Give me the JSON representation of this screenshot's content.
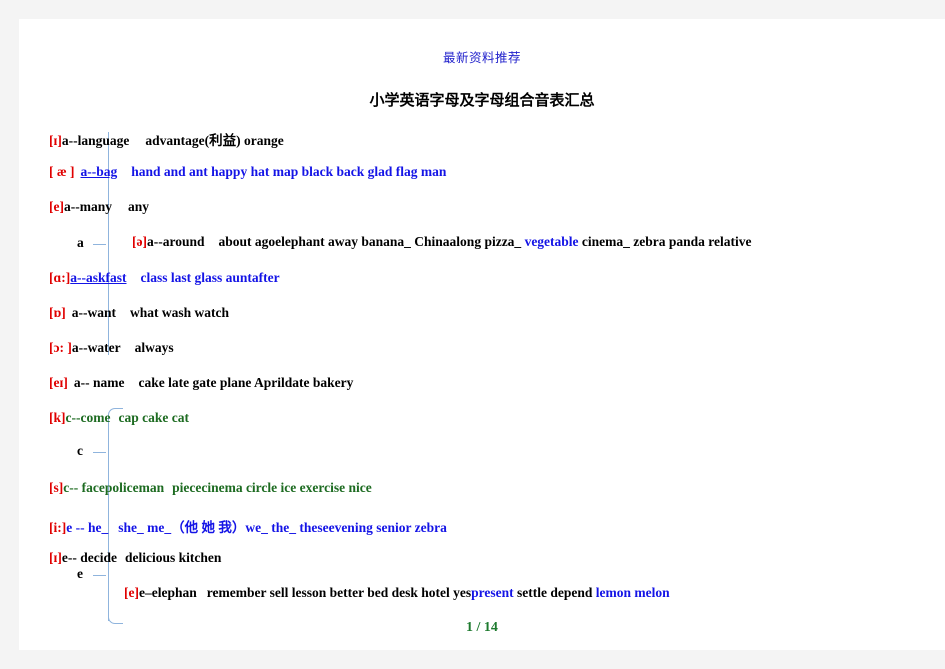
{
  "header": {
    "watermark_text": "最新资料推荐",
    "rule_color": "#2222cc"
  },
  "title": "小学英语字母及字母组合音表汇总",
  "footer": {
    "page_label": "1 / 14",
    "color": "#1d7a2e"
  },
  "colors": {
    "phonetic": "#e00000",
    "black": "#000000",
    "blue": "#1414e6",
    "green": "#1d6b21",
    "bracket": "#8fb4dd"
  },
  "groups": [
    {
      "letter": "a",
      "label": "a"
    },
    {
      "letter": "c",
      "label": "c"
    },
    {
      "letter": "e",
      "label": "e"
    }
  ],
  "rows": [
    {
      "id": "row-i-a",
      "phonetic": "[ɪ]",
      "lead": "a--language",
      "words": "advantage(利益)   orange",
      "color": "black"
    },
    {
      "id": "row-ae-a",
      "phonetic": "[ æ ]",
      "lead": "a--bag",
      "words": "hand   and   ant   happy   hat   map   black   back   glad   flag   man",
      "color": "blue"
    },
    {
      "id": "row-e-a",
      "phonetic": "[e]",
      "lead": "a--many",
      "words": "any",
      "color": "black"
    },
    {
      "id": "row-schwa-a",
      "phonetic": "[ə]",
      "lead": "a--around",
      "words": "about agoelephant   away   banana_   Chinaalong pizza_ vegetable cinema_   zebra panda relative",
      "color": "black",
      "blue_words": [
        "vegetable"
      ]
    },
    {
      "id": "row-aa-a",
      "phonetic": "[ɑ:]",
      "lead": "a--askfast",
      "words": "class   last   glass   auntafter",
      "color": "blue"
    },
    {
      "id": "row-o-a",
      "phonetic": "[ɒ]",
      "lead": "a--want",
      "words": "what   wash   watch",
      "color": "black"
    },
    {
      "id": "row-oo-a",
      "phonetic": "[ɔ: ]",
      "lead": "a--water",
      "words": "always",
      "color": "black"
    },
    {
      "id": "row-ei-a",
      "phonetic": "[eɪ]",
      "lead": "a--  name",
      "words": "cake   late   gate   plane   Aprildate   bakery",
      "color": "black"
    },
    {
      "id": "row-k-c",
      "phonetic": "[k]",
      "lead": "c--come",
      "words": "cap cake   cat",
      "color": "green"
    },
    {
      "id": "row-s-c",
      "phonetic": "[s]",
      "lead": "c--  facepoliceman",
      "words": "piececinema circle   ice   exercise   nice",
      "color": "green"
    },
    {
      "id": "row-ii-e",
      "phonetic": "[i:]",
      "lead": "e -- he_",
      "words": "she_   me_（他 她 我）we_ the_   theseevening   senior   zebra",
      "color": "blue"
    },
    {
      "id": "row-i-e",
      "phonetic": "[ɪ]",
      "lead": "e--  decide",
      "words": "delicious   kitchen",
      "color": "black"
    },
    {
      "id": "row-e-e",
      "phonetic": "[e]",
      "lead": "e–elephan",
      "words": "remember   sell   lesson   better   bed   desk   hotel   yespresent   settle   depend lemon melon",
      "color": "black",
      "blue_words": [
        "present",
        "lemon",
        "melon"
      ]
    }
  ]
}
